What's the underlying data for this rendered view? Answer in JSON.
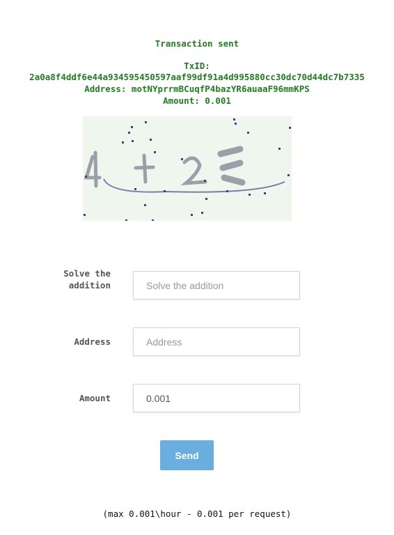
{
  "result": {
    "status": "Transaction sent",
    "txid_label": "TxID:",
    "txid": "2a0a8f4ddf6e44a934595450597aaf99df91a4d995880cc30dc70d44dc7b7335",
    "address_line": "Address: motNYprrmBCuqfP4bazYR6auaaF96mmKPS",
    "amount_line": "Amount: 0.001"
  },
  "captcha": {
    "image_text": "4 + 2 ="
  },
  "form": {
    "captcha_label": "Solve the addition",
    "captcha_placeholder": "Solve the addition",
    "captcha_value": "",
    "address_label": "Address",
    "address_placeholder": "Address",
    "address_value": "",
    "amount_label": "Amount",
    "amount_placeholder": "",
    "amount_value": "0.001",
    "send_label": "Send"
  },
  "footer": {
    "note": "(max 0.001\\hour - 0.001 per request)"
  },
  "colors": {
    "success_text": "#1f7f1f",
    "button_bg": "#6aaee0",
    "captcha_bg": "#eef6ee"
  }
}
